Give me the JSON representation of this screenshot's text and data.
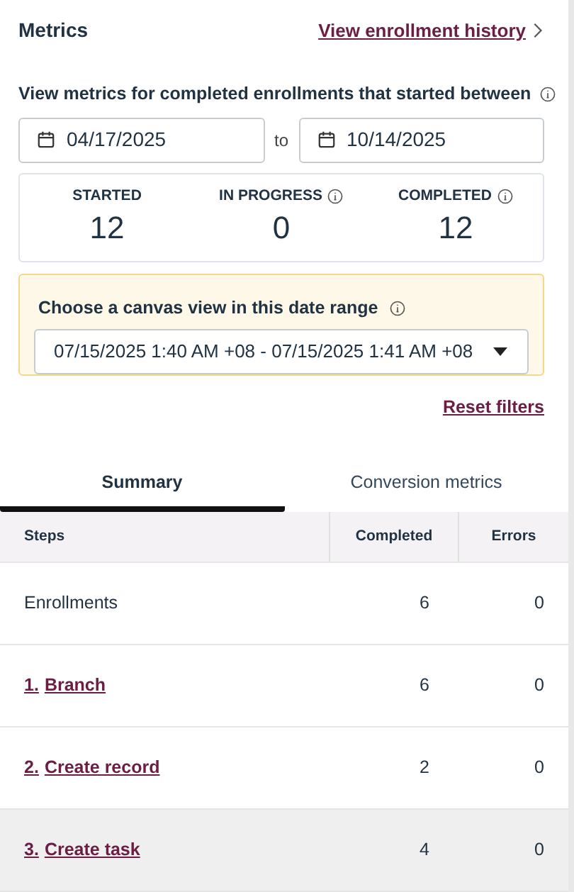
{
  "header": {
    "title": "Metrics",
    "link": "View enrollment history"
  },
  "range": {
    "label": "View metrics for completed enrollments that started between",
    "start": "04/17/2025",
    "separator": "to",
    "end": "10/14/2025"
  },
  "stats": [
    {
      "label": "STARTED",
      "value": "12",
      "info": false
    },
    {
      "label": "IN PROGRESS",
      "value": "0",
      "info": true
    },
    {
      "label": "COMPLETED",
      "value": "12",
      "info": true
    }
  ],
  "canvas_view": {
    "label": "Choose a canvas view in this date range",
    "value": "07/15/2025 1:40 AM +08 - 07/15/2025 1:41 AM +08"
  },
  "reset": "Reset filters",
  "tabs": [
    {
      "label": "Summary",
      "selected": true
    },
    {
      "label": "Conversion metrics",
      "selected": false
    }
  ],
  "table": {
    "columns": [
      "Steps",
      "Completed",
      "Errors"
    ],
    "rows": [
      {
        "kind": "plain",
        "name": "Enrollments",
        "completed": "6",
        "errors": "0",
        "selected": false
      },
      {
        "kind": "link",
        "number": "1.",
        "name": "Branch",
        "completed": "6",
        "errors": "0",
        "selected": false
      },
      {
        "kind": "link",
        "number": "2.",
        "name": "Create record",
        "completed": "2",
        "errors": "0",
        "selected": false
      },
      {
        "kind": "link",
        "number": "3.",
        "name": "Create task",
        "completed": "4",
        "errors": "0",
        "selected": true
      }
    ]
  }
}
